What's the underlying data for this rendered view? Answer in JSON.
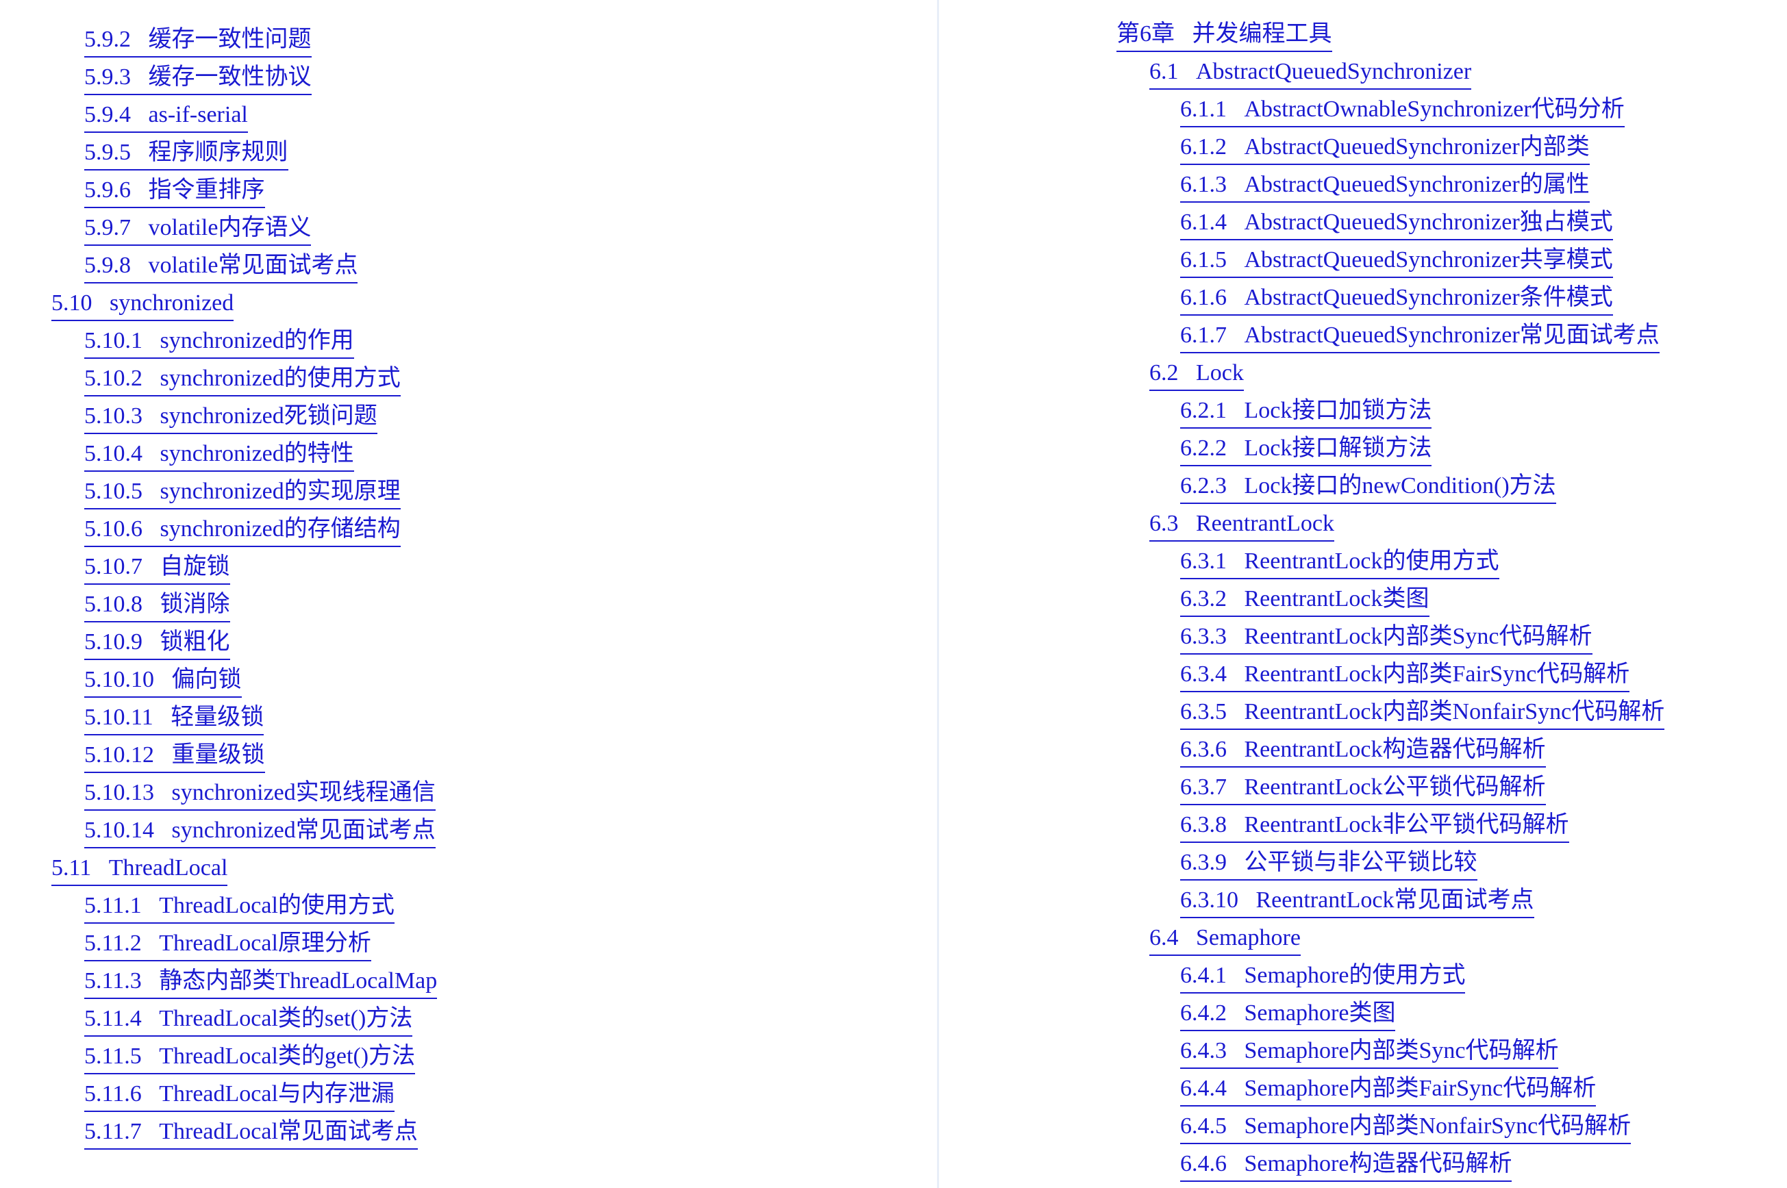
{
  "document": {
    "kind": "table-of-contents",
    "text_color": "#1a1ad0",
    "background_color": "#ffffff",
    "divider_color": "#e8eef8"
  },
  "columns": [
    {
      "name": "left",
      "entries": [
        {
          "level": 3,
          "number": "5.9.2",
          "title": "缓存一致性问题"
        },
        {
          "level": 3,
          "number": "5.9.3",
          "title": "缓存一致性协议"
        },
        {
          "level": 3,
          "number": "5.9.4",
          "title": "as-if-serial"
        },
        {
          "level": 3,
          "number": "5.9.5",
          "title": "程序顺序规则"
        },
        {
          "level": 3,
          "number": "5.9.6",
          "title": "指令重排序"
        },
        {
          "level": 3,
          "number": "5.9.7",
          "title": "volatile内存语义"
        },
        {
          "level": 3,
          "number": "5.9.8",
          "title": "volatile常见面试考点"
        },
        {
          "level": 2,
          "number": "5.10",
          "title": "synchronized"
        },
        {
          "level": 3,
          "number": "5.10.1",
          "title": "synchronized的作用"
        },
        {
          "level": 3,
          "number": "5.10.2",
          "title": "synchronized的使用方式"
        },
        {
          "level": 3,
          "number": "5.10.3",
          "title": "synchronized死锁问题"
        },
        {
          "level": 3,
          "number": "5.10.4",
          "title": "synchronized的特性"
        },
        {
          "level": 3,
          "number": "5.10.5",
          "title": "synchronized的实现原理"
        },
        {
          "level": 3,
          "number": "5.10.6",
          "title": "synchronized的存储结构"
        },
        {
          "level": 3,
          "number": "5.10.7",
          "title": "自旋锁"
        },
        {
          "level": 3,
          "number": "5.10.8",
          "title": "锁消除"
        },
        {
          "level": 3,
          "number": "5.10.9",
          "title": "锁粗化"
        },
        {
          "level": 3,
          "number": "5.10.10",
          "title": "偏向锁"
        },
        {
          "level": 3,
          "number": "5.10.11",
          "title": "轻量级锁"
        },
        {
          "level": 3,
          "number": "5.10.12",
          "title": "重量级锁"
        },
        {
          "level": 3,
          "number": "5.10.13",
          "title": "synchronized实现线程通信"
        },
        {
          "level": 3,
          "number": "5.10.14",
          "title": "synchronized常见面试考点"
        },
        {
          "level": 2,
          "number": "5.11",
          "title": "ThreadLocal"
        },
        {
          "level": 3,
          "number": "5.11.1",
          "title": "ThreadLocal的使用方式"
        },
        {
          "level": 3,
          "number": "5.11.2",
          "title": "ThreadLocal原理分析"
        },
        {
          "level": 3,
          "number": "5.11.3",
          "title": "静态内部类ThreadLocalMap"
        },
        {
          "level": 3,
          "number": "5.11.4",
          "title": "ThreadLocal类的set()方法"
        },
        {
          "level": 3,
          "number": "5.11.5",
          "title": "ThreadLocal类的get()方法"
        },
        {
          "level": 3,
          "number": "5.11.6",
          "title": "ThreadLocal与内存泄漏"
        },
        {
          "level": 3,
          "number": "5.11.7",
          "title": "ThreadLocal常见面试考点"
        }
      ]
    },
    {
      "name": "right",
      "entries": [
        {
          "level": 1,
          "number": "第6章",
          "title": "并发编程工具"
        },
        {
          "level": 2,
          "number": "6.1",
          "title": "AbstractQueuedSynchronizer"
        },
        {
          "level": 3,
          "number": "6.1.1",
          "title": "AbstractOwnableSynchronizer代码分析"
        },
        {
          "level": 3,
          "number": "6.1.2",
          "title": "AbstractQueuedSynchronizer内部类"
        },
        {
          "level": 3,
          "number": "6.1.3",
          "title": "AbstractQueuedSynchronizer的属性"
        },
        {
          "level": 3,
          "number": "6.1.4",
          "title": "AbstractQueuedSynchronizer独占模式"
        },
        {
          "level": 3,
          "number": "6.1.5",
          "title": "AbstractQueuedSynchronizer共享模式"
        },
        {
          "level": 3,
          "number": "6.1.6",
          "title": "AbstractQueuedSynchronizer条件模式"
        },
        {
          "level": 3,
          "number": "6.1.7",
          "title": "AbstractQueuedSynchronizer常见面试考点"
        },
        {
          "level": 2,
          "number": "6.2",
          "title": "Lock"
        },
        {
          "level": 3,
          "number": "6.2.1",
          "title": "Lock接口加锁方法"
        },
        {
          "level": 3,
          "number": "6.2.2",
          "title": "Lock接口解锁方法"
        },
        {
          "level": 3,
          "number": "6.2.3",
          "title": "Lock接口的newCondition()方法"
        },
        {
          "level": 2,
          "number": "6.3",
          "title": "ReentrantLock"
        },
        {
          "level": 3,
          "number": "6.3.1",
          "title": "ReentrantLock的使用方式"
        },
        {
          "level": 3,
          "number": "6.3.2",
          "title": "ReentrantLock类图"
        },
        {
          "level": 3,
          "number": "6.3.3",
          "title": "ReentrantLock内部类Sync代码解析"
        },
        {
          "level": 3,
          "number": "6.3.4",
          "title": "ReentrantLock内部类FairSync代码解析"
        },
        {
          "level": 3,
          "number": "6.3.5",
          "title": "ReentrantLock内部类NonfairSync代码解析"
        },
        {
          "level": 3,
          "number": "6.3.6",
          "title": "ReentrantLock构造器代码解析"
        },
        {
          "level": 3,
          "number": "6.3.7",
          "title": "ReentrantLock公平锁代码解析"
        },
        {
          "level": 3,
          "number": "6.3.8",
          "title": "ReentrantLock非公平锁代码解析"
        },
        {
          "level": 3,
          "number": "6.3.9",
          "title": "公平锁与非公平锁比较"
        },
        {
          "level": 3,
          "number": "6.3.10",
          "title": "ReentrantLock常见面试考点"
        },
        {
          "level": 2,
          "number": "6.4",
          "title": "Semaphore"
        },
        {
          "level": 3,
          "number": "6.4.1",
          "title": "Semaphore的使用方式"
        },
        {
          "level": 3,
          "number": "6.4.2",
          "title": "Semaphore类图"
        },
        {
          "level": 3,
          "number": "6.4.3",
          "title": "Semaphore内部类Sync代码解析"
        },
        {
          "level": 3,
          "number": "6.4.4",
          "title": "Semaphore内部类FairSync代码解析"
        },
        {
          "level": 3,
          "number": "6.4.5",
          "title": "Semaphore内部类NonfairSync代码解析"
        },
        {
          "level": 3,
          "number": "6.4.6",
          "title": "Semaphore构造器代码解析"
        }
      ]
    }
  ]
}
